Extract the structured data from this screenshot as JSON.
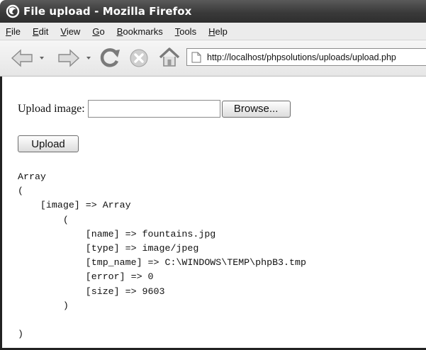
{
  "window": {
    "title": "File upload - Mozilla Firefox"
  },
  "menu": {
    "items": [
      {
        "mnemonic": "F",
        "rest": "ile"
      },
      {
        "mnemonic": "E",
        "rest": "dit"
      },
      {
        "mnemonic": "V",
        "rest": "iew"
      },
      {
        "mnemonic": "G",
        "rest": "o"
      },
      {
        "mnemonic": "B",
        "rest": "ookmarks"
      },
      {
        "mnemonic": "T",
        "rest": "ools"
      },
      {
        "mnemonic": "H",
        "rest": "elp"
      }
    ]
  },
  "toolbar": {
    "icons": [
      "back-arrow-icon",
      "forward-arrow-icon",
      "reload-icon",
      "stop-icon",
      "home-icon",
      "page-icon"
    ],
    "url": "http://localhost/phpsolutions/uploads/upload.php"
  },
  "form": {
    "label": "Upload image:",
    "file_value": "",
    "browse_label": "Browse...",
    "upload_label": "Upload"
  },
  "output": {
    "lines": [
      "Array",
      "(",
      "    [image] => Array",
      "        (",
      "            [name] => fountains.jpg",
      "            [type] => image/jpeg",
      "            [tmp_name] => C:\\WINDOWS\\TEMP\\phpB3.tmp",
      "            [error] => 0",
      "            [size] => 9603",
      "        )",
      "",
      ")"
    ]
  },
  "colors": {
    "titlebar": "#3a3a3a",
    "menubar": "#ececec",
    "content_bg": "#ffffff"
  }
}
